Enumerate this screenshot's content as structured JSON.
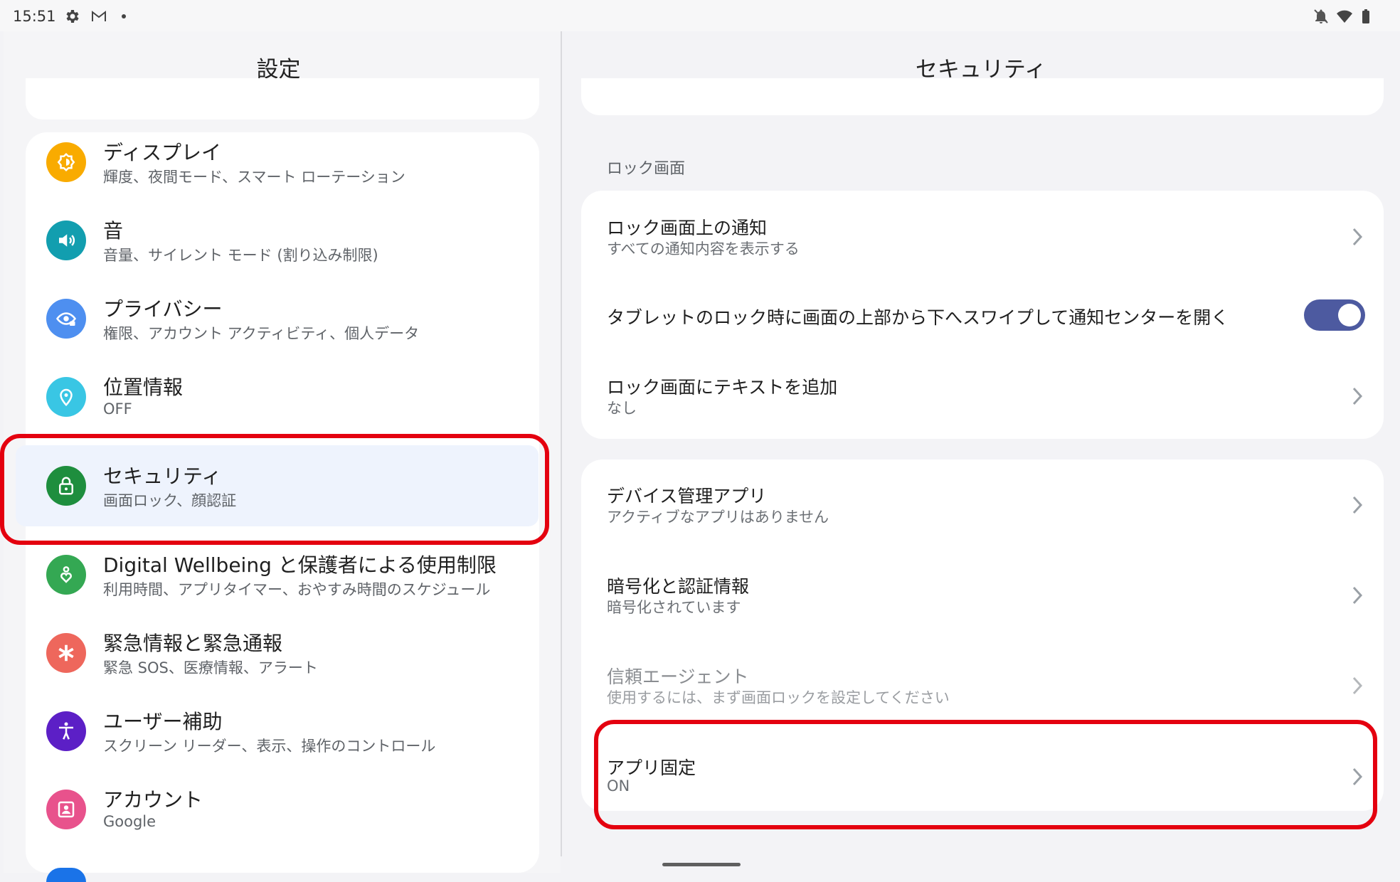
{
  "status_bar": {
    "time": "15:51"
  },
  "left_pane": {
    "title": "設定",
    "items": [
      {
        "title": "ディスプレイ",
        "subtitle": "輝度、夜間モード、スマート ローテーション",
        "icon": "display-icon",
        "color": "#f9ab00"
      },
      {
        "title": "音",
        "subtitle": "音量、サイレント モード (割り込み制限)",
        "icon": "sound-icon",
        "color": "#129eaf"
      },
      {
        "title": "プライバシー",
        "subtitle": "権限、アカウント アクティビティ、個人データ",
        "icon": "privacy-eye-icon",
        "color": "#4e8ff0"
      },
      {
        "title": "位置情報",
        "subtitle": "OFF",
        "icon": "location-pin-icon",
        "color": "#39c6e4"
      },
      {
        "title": "セキュリティ",
        "subtitle": "画面ロック、顔認証",
        "icon": "lock-icon",
        "color": "#1e8e3e"
      },
      {
        "title": "Digital Wellbeing と保護者による使用制限",
        "subtitle": "利用時間、アプリタイマー、おやすみ時間のスケジュール",
        "icon": "wellbeing-heart-icon",
        "color": "#34a853"
      },
      {
        "title": "緊急情報と緊急通報",
        "subtitle": "緊急 SOS、医療情報、アラート",
        "icon": "emergency-asterisk-icon",
        "color": "#ee675c"
      },
      {
        "title": "ユーザー補助",
        "subtitle": "スクリーン リーダー、表示、操作のコントロール",
        "icon": "accessibility-icon",
        "color": "#5c1fc6"
      },
      {
        "title": "アカウント",
        "subtitle": "Google",
        "icon": "account-icon",
        "color": "#e8528c"
      }
    ],
    "selected_index": 4
  },
  "right_pane": {
    "title": "セキュリティ",
    "section_label": "ロック画面",
    "lock_screen_items": [
      {
        "title": "ロック画面上の通知",
        "subtitle": "すべての通知内容を表示する"
      },
      {
        "title": "タブレットのロック時に画面の上部から下へスワイプして通知センターを開く",
        "toggle_on": true
      },
      {
        "title": "ロック画面にテキストを追加",
        "subtitle": "なし"
      }
    ],
    "other_items": [
      {
        "title": "デバイス管理アプリ",
        "subtitle": "アクティブなアプリはありません"
      },
      {
        "title": "暗号化と認証情報",
        "subtitle": "暗号化されています"
      },
      {
        "title": "信頼エージェント",
        "subtitle": "使用するには、まず画面ロックを設定してください",
        "disabled": true
      },
      {
        "title": "アプリ固定",
        "subtitle": "ON"
      }
    ]
  },
  "colors": {
    "highlight": "#e4000f",
    "toggle_track": "#4d5aa0",
    "selected_bg": "#eef3fd"
  }
}
